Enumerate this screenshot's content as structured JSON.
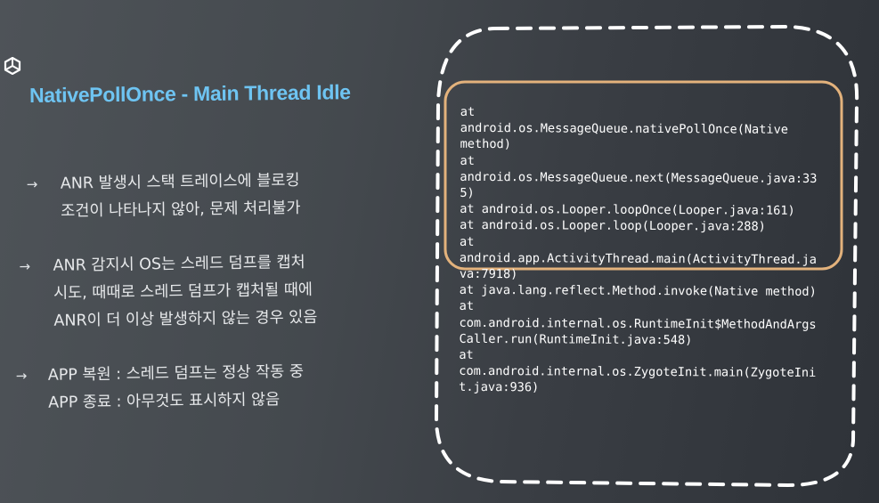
{
  "slide": {
    "title": "NativePollOnce - Main Thread Idle",
    "arrow_glyph": "→",
    "bullets": [
      {
        "lines": [
          "ANR 발생시 스택 트레이스에 블로킹",
          "조건이 나타나지 않아, 문제 처리불가"
        ]
      },
      {
        "lines": [
          "ANR 감지시 OS는 스레드 덤프를 캡처",
          "시도, 때때로 스레드 덤프가 캡처될 때에",
          "ANR이 더 이상 발생하지 않는 경우 있음"
        ]
      },
      {
        "lines": [
          "APP 복원 : 스레드 덤프는 정상 작동 중",
          "APP 종료 : 아무것도 표시하지 않음"
        ]
      }
    ]
  },
  "stack_trace": [
    "at",
    "android.os.MessageQueue.nativePollOnce(Native",
    "method)",
    "at",
    "android.os.MessageQueue.next(MessageQueue.java:33",
    "5)",
    "at android.os.Looper.loopOnce(Looper.java:161)",
    "at android.os.Looper.loop(Looper.java:288)",
    "at",
    "android.app.ActivityThread.main(ActivityThread.ja",
    "va:7918)",
    "at java.lang.reflect.Method.invoke(Native method)",
    "at",
    "com.android.internal.os.RuntimeInit$MethodAndArgs",
    "Caller.run(RuntimeInit.java:548)",
    "at",
    "com.android.internal.os.ZygoteInit.main(ZygoteIni",
    "t.java:936)"
  ],
  "colors": {
    "title": "#6ec4f2",
    "highlight_box": "#e3b27c",
    "dashed_frame": "#ffffff",
    "text": "#e6e8ea"
  },
  "icons": [
    "unity-logo-icon",
    "right-arrow-icon"
  ]
}
